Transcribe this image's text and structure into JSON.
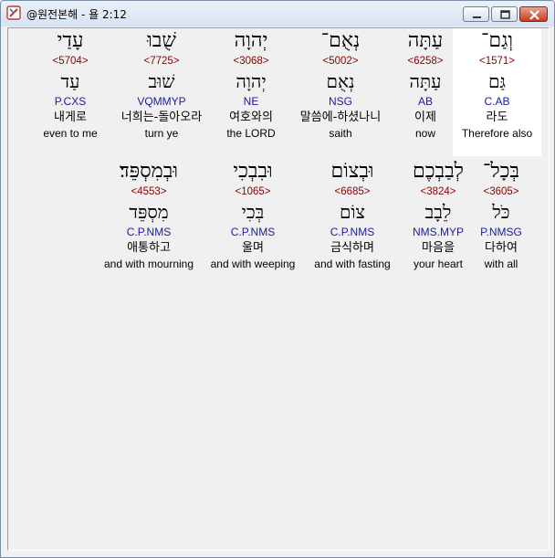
{
  "window": {
    "title": "@원전본해 - 욜 2:12"
  },
  "verse": {
    "rows": [
      [
        {
          "hebrew": "וְגַם־",
          "strong": "<1571>",
          "lemma": "גַּם",
          "morph": "C.AB",
          "korean": "라도",
          "english": "Therefore also",
          "selected": true
        },
        {
          "hebrew": "עַתָּה",
          "strong": "<6258>",
          "lemma": "עַתָּה",
          "morph": "AB",
          "korean": "이제",
          "english": "now"
        },
        {
          "hebrew": "נְאֻם־",
          "strong": "<5002>",
          "lemma": "נְאֻם",
          "morph": "NSG",
          "korean": "말씀에-하셨나니",
          "english": "saith"
        },
        {
          "hebrew": "יְהוָה",
          "strong": "<3068>",
          "lemma": "יְהוָה",
          "morph": "NE",
          "korean": "여호와의",
          "english": "the LORD"
        },
        {
          "hebrew": "שֻׁבוּ",
          "strong": "<7725>",
          "lemma": "שׁוּב",
          "morph": "VQMMYP",
          "korean": "너희는-돌아오라",
          "english": "turn ye"
        },
        {
          "hebrew": "עָדַי",
          "strong": "<5704>",
          "lemma": "עַד",
          "morph": "P.CXS",
          "korean": "내게로",
          "english": "even to me"
        }
      ],
      [
        {
          "hebrew": "בְּכָל־",
          "strong": "<3605>",
          "lemma": "כֹּל",
          "morph": "P.NMSG",
          "korean": "다하여",
          "english": "with all"
        },
        {
          "hebrew": "לְבַבְכֶם",
          "strong": "<3824>",
          "lemma": "לֵבָב",
          "morph": "NMS.MYP",
          "korean": "마음을",
          "english": "your heart"
        },
        {
          "hebrew": "וּבְצוֹם",
          "strong": "<6685>",
          "lemma": "צוֹם",
          "morph": "C.P.NMS",
          "korean": "금식하며",
          "english": "and with fasting"
        },
        {
          "hebrew": "וּבִבְכִי",
          "strong": "<1065>",
          "lemma": "בְּכִי",
          "morph": "C.P.NMS",
          "korean": "울며",
          "english": "and with weeping"
        },
        {
          "hebrew": "וּבְמִסְפֵּד׃",
          "strong": "<4553>",
          "lemma": "מִסְפֵּד",
          "morph": "C.P.NMS",
          "korean": "애통하고",
          "english": "and with mourning"
        }
      ]
    ]
  }
}
